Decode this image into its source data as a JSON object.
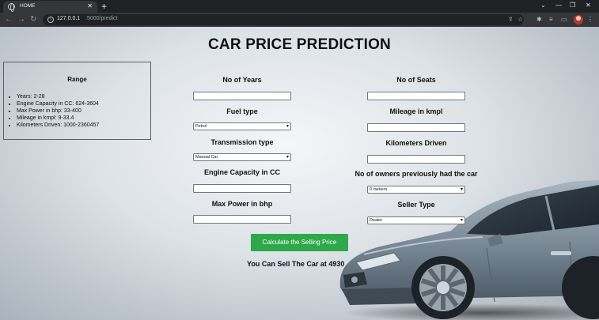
{
  "browser": {
    "tab_title": "HOME",
    "tab_close": "✕",
    "new_tab": "+",
    "url_host": "127.0.0.1",
    "url_path": ":5000/predict",
    "minimize": "—",
    "maximize": "❐",
    "close": "✕"
  },
  "page": {
    "title": "CAR PRICE PREDICTION",
    "range": {
      "heading": "Range",
      "items": [
        "Years: 2-28",
        "Engine Capacity in CC: 624-3604",
        "Max Power in bhp: 33-400",
        "Mileage in kmpl: 9-33.4",
        "Kilometers Driven: 1000-2360457"
      ]
    },
    "left_fields": {
      "years_label": "No of Years",
      "fuel_label": "Fuel type",
      "fuel_value": "Petrol",
      "transmission_label": "Transmission type",
      "transmission_value": "Manual Car",
      "engine_label": "Engine Capacity in CC",
      "power_label": "Max Power in bhp"
    },
    "right_fields": {
      "seats_label": "No of Seats",
      "mileage_label": "Mileage in kmpl",
      "km_label": "Kilometers Driven",
      "owners_label": "No of owners previously had the car",
      "owners_value": "0 owners",
      "seller_label": "Seller Type",
      "seller_value": "Dealer"
    },
    "calculate_label": "Calculate the Selling Price",
    "result": "You Can Sell The Car at 4930"
  },
  "icons": [
    "globe-icon",
    "back-icon",
    "forward-icon",
    "reload-icon",
    "info-icon",
    "share-icon",
    "star-icon",
    "extensions-icon",
    "reading-list-icon",
    "split-view-icon",
    "avatar",
    "menu-icon"
  ]
}
